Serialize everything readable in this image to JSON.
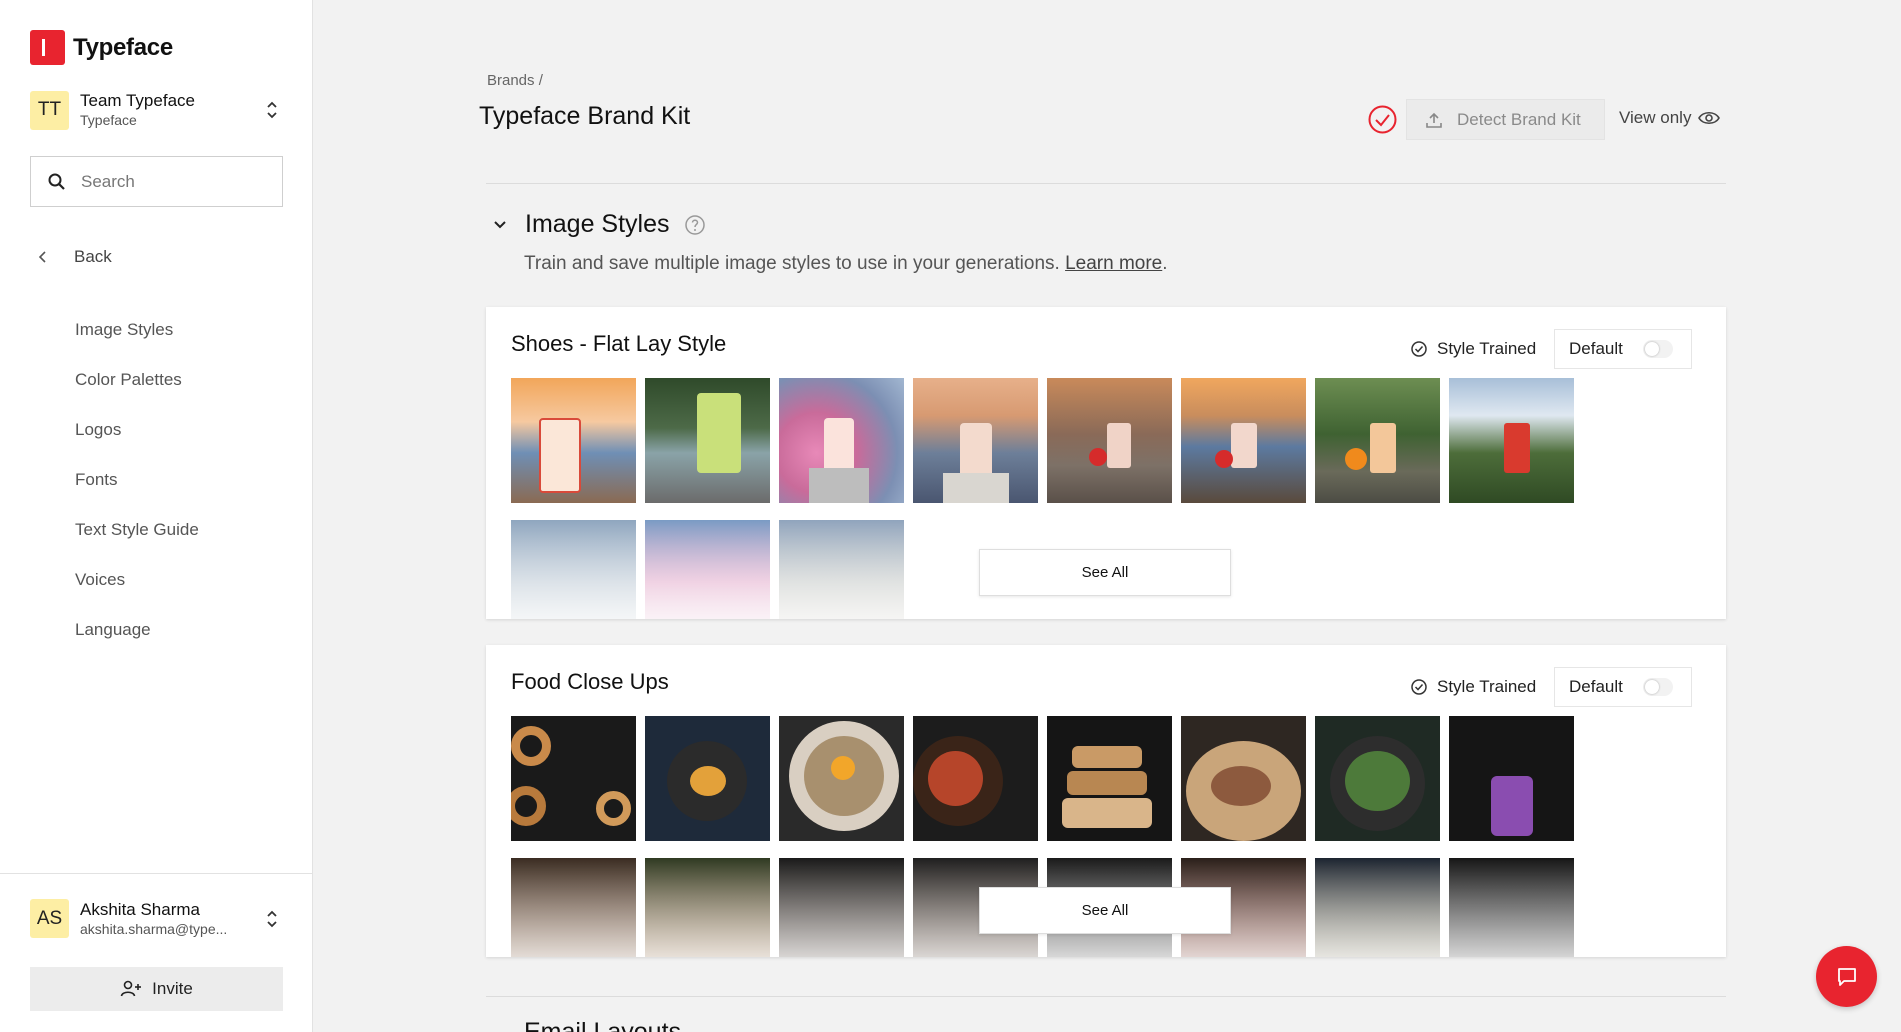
{
  "app": {
    "name": "Typeface",
    "accent": "#e8242f"
  },
  "team": {
    "initials": "TT",
    "name": "Team Typeface",
    "workspace": "Typeface"
  },
  "search": {
    "placeholder": "Search"
  },
  "nav": {
    "back_label": "Back",
    "items": [
      "Image Styles",
      "Color Palettes",
      "Logos",
      "Fonts",
      "Text Style Guide",
      "Voices",
      "Language"
    ]
  },
  "user": {
    "initials": "AS",
    "name": "Akshita Sharma",
    "email": "akshita.sharma@type..."
  },
  "invite_label": "Invite",
  "header": {
    "breadcrumb": "Brands /",
    "title": "Typeface Brand Kit",
    "detect_label": "Detect Brand Kit",
    "view_only_label": "View only"
  },
  "section": {
    "title": "Image Styles",
    "description": "Train and save multiple image styles to use in your generations.",
    "learn_more": "Learn more",
    "period": "."
  },
  "styles": [
    {
      "title": "Shoes - Flat Lay Style",
      "status": "Style Trained",
      "default_label": "Default",
      "see_all": "See All",
      "images": [
        "skyline-can",
        "forest-green-can",
        "cherry-blossom-can",
        "city-pedestal-can",
        "bridge-strawberry-can",
        "coast-strawberry-can",
        "orange-can",
        "mountain-red-can"
      ],
      "faded_images": [
        "misty-forest",
        "blossom-city",
        "lighthouse"
      ]
    },
    {
      "title": "Food Close Ups",
      "status": "Style Trained",
      "default_label": "Default",
      "see_all": "See All",
      "images": [
        "bagels",
        "skillet-berries",
        "noodle-bowl",
        "stir-fry",
        "stacked-bread",
        "pizza",
        "salad-bowl",
        "berry-smoothie"
      ],
      "faded_images": [
        "pancakes",
        "citrus-board",
        "dark-dish",
        "dark-pan",
        "dark-plate",
        "dark-veg",
        "pasta",
        "dark-drink"
      ]
    }
  ],
  "next_section_partial": "Email Layouts"
}
